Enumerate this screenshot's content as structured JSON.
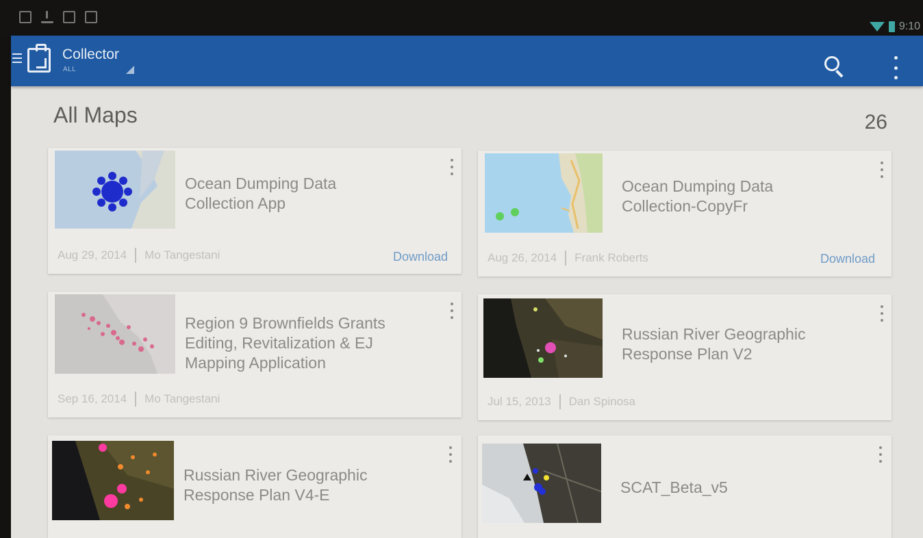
{
  "status_bar": {
    "time": "9:10"
  },
  "toolbar": {
    "title": "Collector",
    "subtitle": "ALL"
  },
  "content": {
    "heading": "All Maps",
    "count": "26",
    "cards": [
      {
        "title_line1": "Ocean Dumping Data",
        "title_line2": "Collection App",
        "date": "Aug 29, 2014",
        "author": "Mo Tangestani",
        "action": "Download"
      },
      {
        "title_line1": "Ocean Dumping Data",
        "title_line2": "Collection-CopyFr",
        "date": "Aug 26, 2014",
        "author": "Frank Roberts",
        "action": "Download"
      },
      {
        "title_line1": "Region 9 Brownfields Grants",
        "title_line2": "Editing, Revitalization & EJ",
        "title_line3": "Mapping Application",
        "date": "Sep 16, 2014",
        "author": "Mo Tangestani"
      },
      {
        "title_line1": "Russian River Geographic",
        "title_line2": "Response Plan V2",
        "date": "Jul 15, 2013",
        "author": "Dan Spinosa"
      },
      {
        "title_line1": "Russian River Geographic",
        "title_line2": "Response Plan V4-E"
      },
      {
        "title_line1": "SCAT_Beta_v5"
      }
    ]
  },
  "icons": [
    "menu-icon",
    "collector-app-icon",
    "dropdown-icon",
    "search-icon",
    "overflow-menu-icon",
    "card-overflow-icon",
    "wifi-icon",
    "battery-icon"
  ],
  "colors": {
    "toolbar": "#1f5aa2",
    "download_link": "#6f9bc6",
    "background": "#e4e2de"
  }
}
